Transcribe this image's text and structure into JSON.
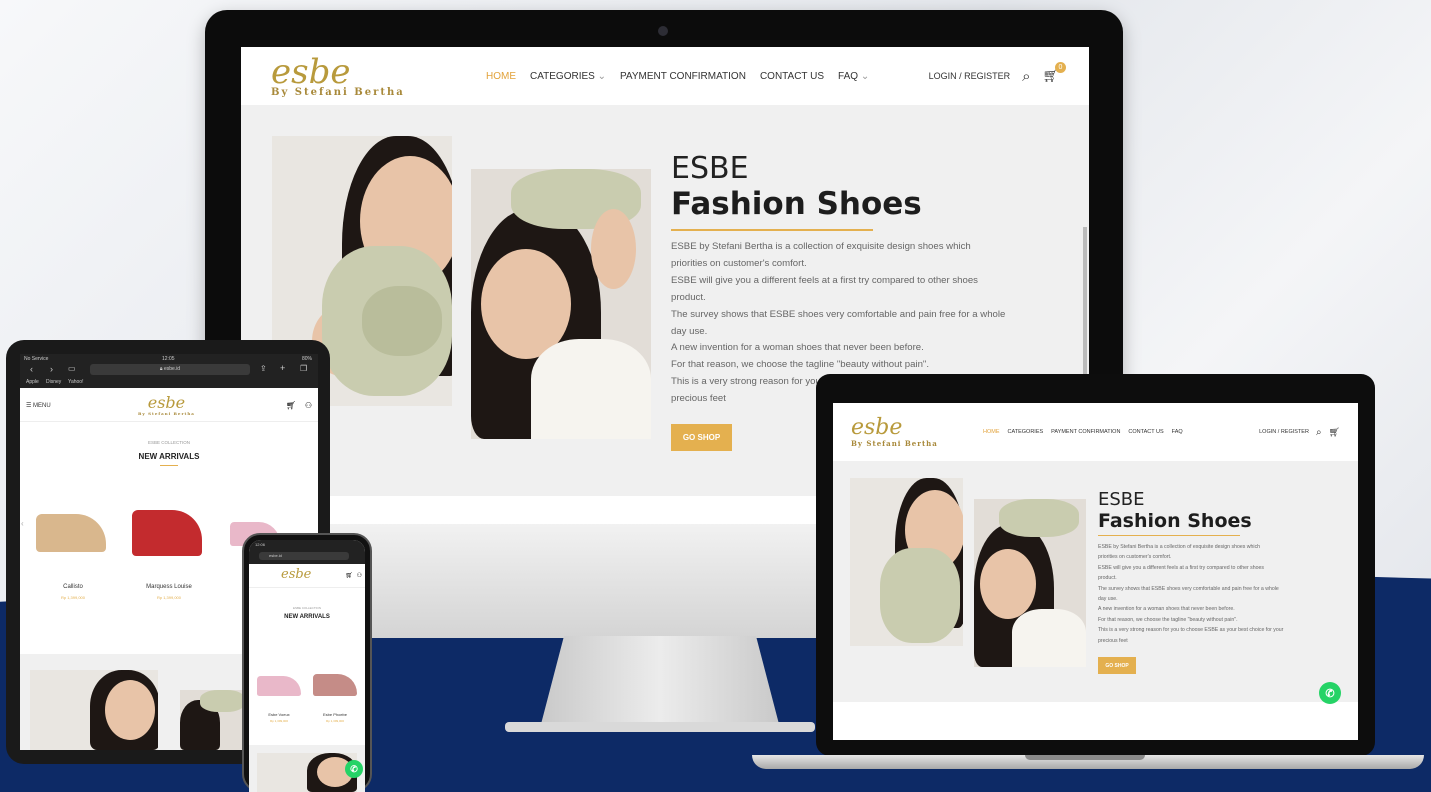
{
  "brand": {
    "logo": "esbe",
    "tagline": "By Stefani Bertha"
  },
  "nav": {
    "home": "HOME",
    "categories": "CATEGORIES",
    "payment": "PAYMENT CONFIRMATION",
    "contact": "CONTACT US",
    "faq": "FAQ",
    "login": "LOGIN / REGISTER",
    "cart_count": "0"
  },
  "hero": {
    "title": "ESBE",
    "subtitle": "Fashion Shoes",
    "lines": [
      "ESBE by Stefani Bertha is a collection of exquisite design shoes which",
      "priorities on customer's comfort.",
      "ESBE will give you a different feels at a first try compared to other shoes",
      "product.",
      "The survey shows that ESBE shoes very comfortable and pain free for a whole",
      "day use.",
      "A new invention for a woman shoes that never been before.",
      "For that reason, we choose the tagline \"beauty without pain\".",
      "This is a very strong reason for you to choose ESBE as your best choice for your",
      "precious feet"
    ],
    "cta": "GO SHOP"
  },
  "tablet": {
    "status_left": "No Service",
    "status_time": "12:05",
    "status_right": "80%",
    "url": "esbe.id",
    "bookmarks": [
      "Apple",
      "Disney",
      "Yahoo!"
    ],
    "menu": "MENU",
    "kicker": "ESBE COLLECTION",
    "heading": "NEW ARRIVALS",
    "products": [
      {
        "name": "Callisto",
        "price": "Rp 1,399,000"
      },
      {
        "name": "Marquess Louise",
        "price": "Rp 1,399,000"
      }
    ]
  },
  "phone": {
    "status_time": "12:06",
    "url": "esbe.id",
    "kicker": "ESBE COLLECTION",
    "heading": "NEW ARRIVALS",
    "products": [
      {
        "name": "Esbe Voeux",
        "price": "Rp 1,399,000"
      },
      {
        "name": "Esbe Phoebe",
        "price": "Rp 1,399,000"
      }
    ]
  },
  "colors": {
    "accent": "#e4b04f",
    "navy": "#0d2a66",
    "whatsapp": "#25d366"
  }
}
